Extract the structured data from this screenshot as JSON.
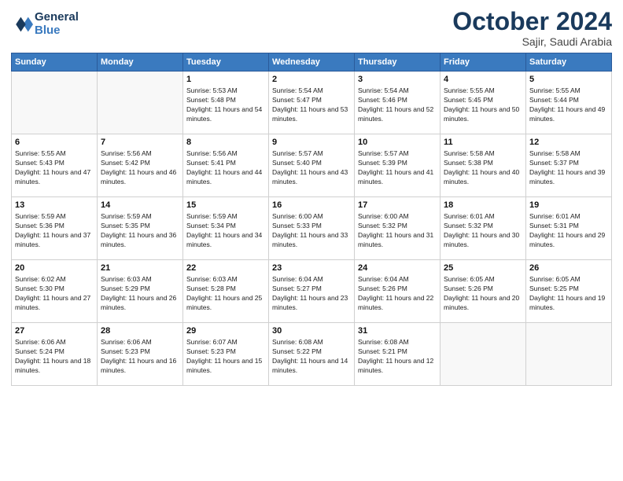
{
  "logo": {
    "line1": "General",
    "line2": "Blue"
  },
  "title": "October 2024",
  "subtitle": "Sajir, Saudi Arabia",
  "days_of_week": [
    "Sunday",
    "Monday",
    "Tuesday",
    "Wednesday",
    "Thursday",
    "Friday",
    "Saturday"
  ],
  "weeks": [
    [
      {
        "day": "",
        "info": ""
      },
      {
        "day": "",
        "info": ""
      },
      {
        "day": "1",
        "info": "Sunrise: 5:53 AM\nSunset: 5:48 PM\nDaylight: 11 hours and 54 minutes."
      },
      {
        "day": "2",
        "info": "Sunrise: 5:54 AM\nSunset: 5:47 PM\nDaylight: 11 hours and 53 minutes."
      },
      {
        "day": "3",
        "info": "Sunrise: 5:54 AM\nSunset: 5:46 PM\nDaylight: 11 hours and 52 minutes."
      },
      {
        "day": "4",
        "info": "Sunrise: 5:55 AM\nSunset: 5:45 PM\nDaylight: 11 hours and 50 minutes."
      },
      {
        "day": "5",
        "info": "Sunrise: 5:55 AM\nSunset: 5:44 PM\nDaylight: 11 hours and 49 minutes."
      }
    ],
    [
      {
        "day": "6",
        "info": "Sunrise: 5:55 AM\nSunset: 5:43 PM\nDaylight: 11 hours and 47 minutes."
      },
      {
        "day": "7",
        "info": "Sunrise: 5:56 AM\nSunset: 5:42 PM\nDaylight: 11 hours and 46 minutes."
      },
      {
        "day": "8",
        "info": "Sunrise: 5:56 AM\nSunset: 5:41 PM\nDaylight: 11 hours and 44 minutes."
      },
      {
        "day": "9",
        "info": "Sunrise: 5:57 AM\nSunset: 5:40 PM\nDaylight: 11 hours and 43 minutes."
      },
      {
        "day": "10",
        "info": "Sunrise: 5:57 AM\nSunset: 5:39 PM\nDaylight: 11 hours and 41 minutes."
      },
      {
        "day": "11",
        "info": "Sunrise: 5:58 AM\nSunset: 5:38 PM\nDaylight: 11 hours and 40 minutes."
      },
      {
        "day": "12",
        "info": "Sunrise: 5:58 AM\nSunset: 5:37 PM\nDaylight: 11 hours and 39 minutes."
      }
    ],
    [
      {
        "day": "13",
        "info": "Sunrise: 5:59 AM\nSunset: 5:36 PM\nDaylight: 11 hours and 37 minutes."
      },
      {
        "day": "14",
        "info": "Sunrise: 5:59 AM\nSunset: 5:35 PM\nDaylight: 11 hours and 36 minutes."
      },
      {
        "day": "15",
        "info": "Sunrise: 5:59 AM\nSunset: 5:34 PM\nDaylight: 11 hours and 34 minutes."
      },
      {
        "day": "16",
        "info": "Sunrise: 6:00 AM\nSunset: 5:33 PM\nDaylight: 11 hours and 33 minutes."
      },
      {
        "day": "17",
        "info": "Sunrise: 6:00 AM\nSunset: 5:32 PM\nDaylight: 11 hours and 31 minutes."
      },
      {
        "day": "18",
        "info": "Sunrise: 6:01 AM\nSunset: 5:32 PM\nDaylight: 11 hours and 30 minutes."
      },
      {
        "day": "19",
        "info": "Sunrise: 6:01 AM\nSunset: 5:31 PM\nDaylight: 11 hours and 29 minutes."
      }
    ],
    [
      {
        "day": "20",
        "info": "Sunrise: 6:02 AM\nSunset: 5:30 PM\nDaylight: 11 hours and 27 minutes."
      },
      {
        "day": "21",
        "info": "Sunrise: 6:03 AM\nSunset: 5:29 PM\nDaylight: 11 hours and 26 minutes."
      },
      {
        "day": "22",
        "info": "Sunrise: 6:03 AM\nSunset: 5:28 PM\nDaylight: 11 hours and 25 minutes."
      },
      {
        "day": "23",
        "info": "Sunrise: 6:04 AM\nSunset: 5:27 PM\nDaylight: 11 hours and 23 minutes."
      },
      {
        "day": "24",
        "info": "Sunrise: 6:04 AM\nSunset: 5:26 PM\nDaylight: 11 hours and 22 minutes."
      },
      {
        "day": "25",
        "info": "Sunrise: 6:05 AM\nSunset: 5:26 PM\nDaylight: 11 hours and 20 minutes."
      },
      {
        "day": "26",
        "info": "Sunrise: 6:05 AM\nSunset: 5:25 PM\nDaylight: 11 hours and 19 minutes."
      }
    ],
    [
      {
        "day": "27",
        "info": "Sunrise: 6:06 AM\nSunset: 5:24 PM\nDaylight: 11 hours and 18 minutes."
      },
      {
        "day": "28",
        "info": "Sunrise: 6:06 AM\nSunset: 5:23 PM\nDaylight: 11 hours and 16 minutes."
      },
      {
        "day": "29",
        "info": "Sunrise: 6:07 AM\nSunset: 5:23 PM\nDaylight: 11 hours and 15 minutes."
      },
      {
        "day": "30",
        "info": "Sunrise: 6:08 AM\nSunset: 5:22 PM\nDaylight: 11 hours and 14 minutes."
      },
      {
        "day": "31",
        "info": "Sunrise: 6:08 AM\nSunset: 5:21 PM\nDaylight: 11 hours and 12 minutes."
      },
      {
        "day": "",
        "info": ""
      },
      {
        "day": "",
        "info": ""
      }
    ]
  ]
}
